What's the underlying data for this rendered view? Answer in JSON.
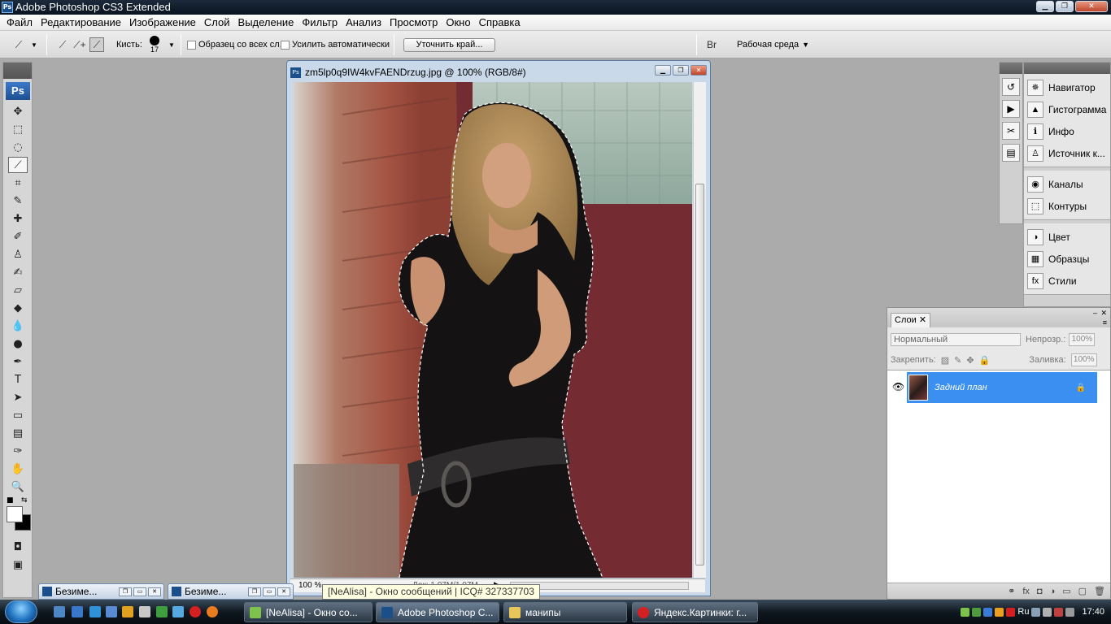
{
  "app": {
    "title": "Adobe Photoshop CS3 Extended",
    "logo": "Ps"
  },
  "menu": [
    "Файл",
    "Редактирование",
    "Изображение",
    "Слой",
    "Выделение",
    "Фильтр",
    "Анализ",
    "Просмотр",
    "Окно",
    "Справка"
  ],
  "options": {
    "brush_label": "Кисть:",
    "brush_size": "17",
    "sample_all": "Образец со всех сл.",
    "auto_enhance": "Усилить автоматически",
    "refine_edge": "Уточнить край...",
    "workspace": "Рабочая среда"
  },
  "document": {
    "title": "zm5lp0q9IW4kvFAENDrzug.jpg @ 100% (RGB/8#)",
    "zoom": "100 %",
    "doc_info": "Док: 1,07М/1,07М"
  },
  "tooltip": "[NeAlisa] - Окно сообщений | ICQ# 327337703",
  "panels": {
    "group1": [
      "Навигатор",
      "Гистограмма",
      "Инфо",
      "Источник к..."
    ],
    "group2": [
      "Каналы",
      "Контуры"
    ],
    "group3": [
      "Цвет",
      "Образцы",
      "Стили"
    ]
  },
  "layers": {
    "tab": "Слои",
    "blend_mode": "Нормальный",
    "opacity_label": "Непрозр.:",
    "opacity": "100%",
    "lock_label": "Закрепить:",
    "fill_label": "Заливка:",
    "fill": "100%",
    "layer_name": "Задний план",
    "footer_fx": "fx"
  },
  "minimized_docs": [
    "Безиме...",
    "Безиме..."
  ],
  "taskbar": {
    "tasks": [
      "[NeAlisa] - Окно со...",
      "Adobe Photoshop C...",
      "манипы",
      "Яндекс.Картинки: г..."
    ],
    "lang": "Ru",
    "time": "17:40"
  }
}
